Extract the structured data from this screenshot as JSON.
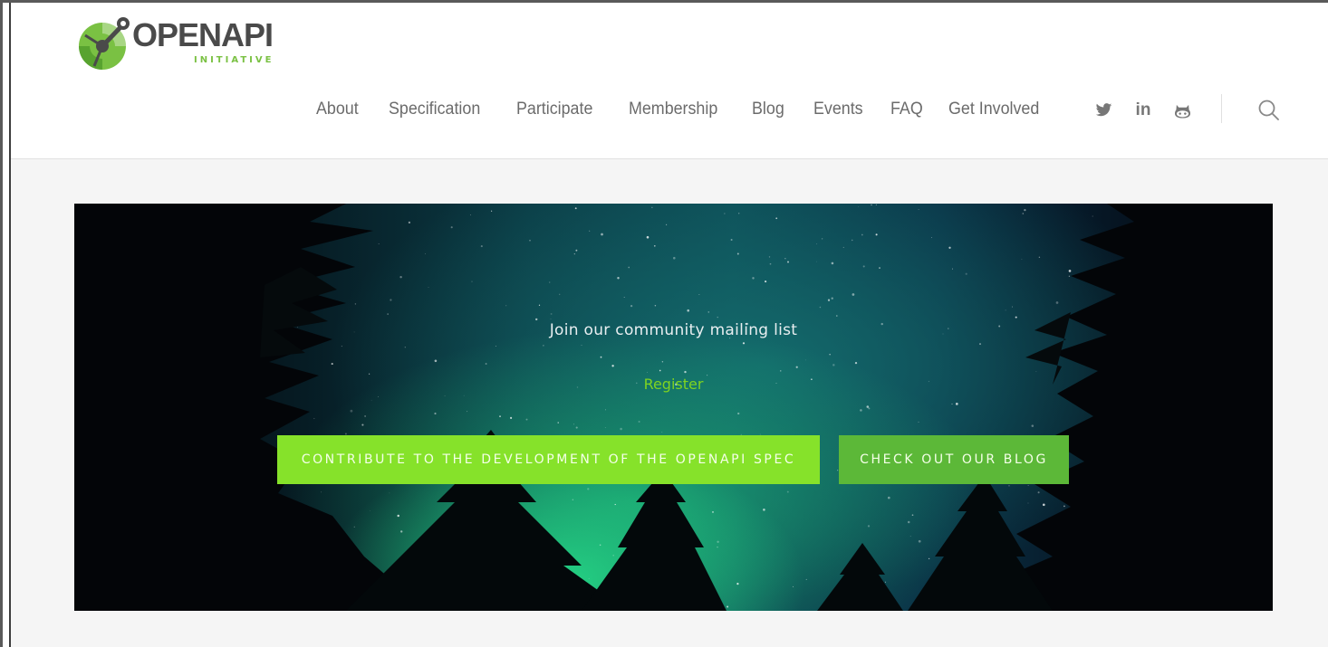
{
  "brand": {
    "name": "OPENAPI",
    "tagline": "INITIATIVE",
    "colors": {
      "green": "#7ac143",
      "dark": "#4a4a4a"
    }
  },
  "nav": {
    "items": [
      {
        "label": "About"
      },
      {
        "label": "Specification"
      },
      {
        "label": "Participate"
      },
      {
        "label": "Membership"
      },
      {
        "label": "Blog"
      },
      {
        "label": "Events"
      },
      {
        "label": "FAQ"
      },
      {
        "label": "Get Involved"
      }
    ],
    "social": [
      {
        "icon": "twitter-icon"
      },
      {
        "icon": "linkedin-icon",
        "text": "in"
      },
      {
        "icon": "github-icon"
      }
    ],
    "search": {
      "icon": "search-icon"
    }
  },
  "hero": {
    "mailing_text": "Join our community mailing list",
    "register_label": "Register",
    "buttons": {
      "primary": "CONTRIBUTE TO THE DEVELOPMENT OF THE OPENAPI SPEC",
      "secondary": "CHECK OUT OUR BLOG"
    },
    "colors": {
      "primary_button": "#86e22a",
      "secondary_button": "#5cb838",
      "link": "#7ed321"
    }
  }
}
